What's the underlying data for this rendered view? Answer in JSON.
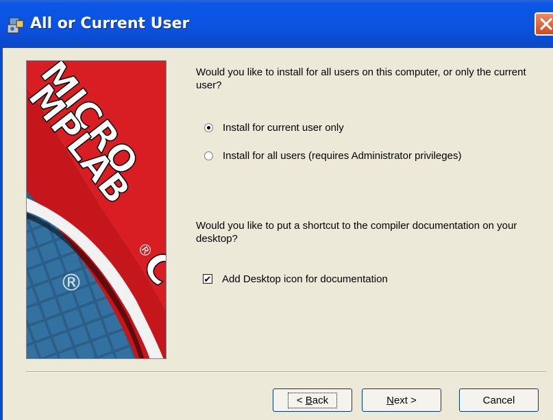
{
  "window": {
    "title": "All or Current User",
    "title_icon": "installer-icon",
    "close_glyph": "✕"
  },
  "banner": {
    "brand_line1": "MICRO",
    "brand_line2": "MPLAB",
    "registered": "®",
    "letter": "C",
    "colors": {
      "red": "#d81e22",
      "blue": "#2f6e9a",
      "white": "#ffffff"
    }
  },
  "install_scope": {
    "question": "Would you like to install for all users on this computer, or only the current user?",
    "options": [
      {
        "label": "Install for current user only",
        "selected": true
      },
      {
        "label": "Install for all users (requires Administrator privileges)",
        "selected": false
      }
    ]
  },
  "shortcut": {
    "question": "Would you like to put a shortcut to the compiler documentation on your desktop?",
    "checkbox_label": "Add Desktop icon for documentation",
    "checked": true,
    "check_glyph": "✔"
  },
  "buttons": {
    "back": {
      "prefix": "< ",
      "mnemonic": "B",
      "rest": "ack"
    },
    "next": {
      "mnemonic": "N",
      "rest": "ext >"
    },
    "cancel": "Cancel"
  }
}
